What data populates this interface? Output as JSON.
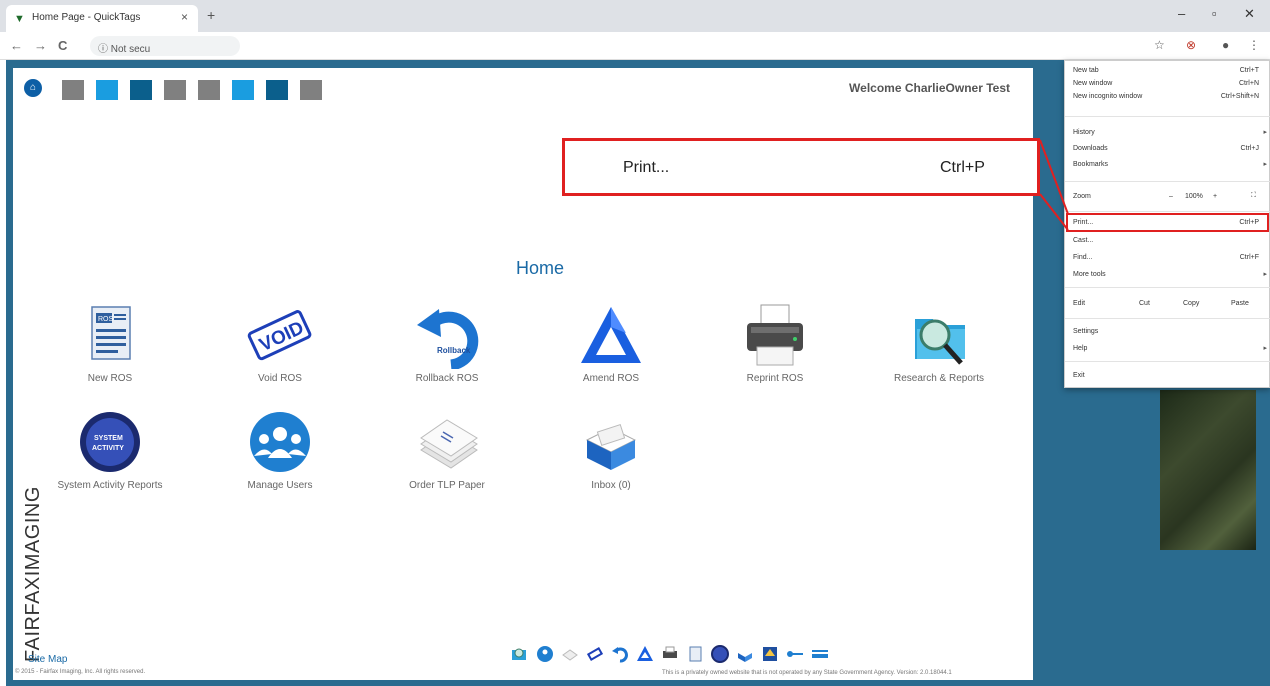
{
  "browser": {
    "tab_title": "Home Page - QuickTags",
    "tab_close": "×",
    "new_tab": "+",
    "address": "ⓘ Not secu",
    "window_controls": [
      "–",
      "▫",
      "✕"
    ],
    "nav": {
      "back": "←",
      "forward": "→",
      "reload": "C"
    },
    "toolbar_icons": {
      "star": "☆",
      "extension": "⊗",
      "profile": "●",
      "menu": "⋮"
    }
  },
  "page": {
    "welcome": "Welcome CharlieOwner Test",
    "title": "Home",
    "nav_tile_colors": [
      "#808080",
      "#1a9de0",
      "#0b5f8c",
      "#808080",
      "#808080",
      "#1a9de0",
      "#0b5f8c",
      "#808080"
    ],
    "menu_items": [
      {
        "label": "New ROS",
        "icon": "new-ros-icon"
      },
      {
        "label": "Void ROS",
        "icon": "void-stamp-icon"
      },
      {
        "label": "Rollback ROS",
        "icon": "rollback-arrow-icon"
      },
      {
        "label": "Amend ROS",
        "icon": "triangle-icon"
      },
      {
        "label": "Reprint ROS",
        "icon": "printer-icon"
      },
      {
        "label": "Research & Reports",
        "icon": "folder-magnifier-icon"
      },
      {
        "label": "System Activity Reports",
        "icon": "system-activity-icon"
      },
      {
        "label": "Manage Users",
        "icon": "users-icon"
      },
      {
        "label": "Order TLP Paper",
        "icon": "paper-stack-icon"
      },
      {
        "label": "Inbox (0)",
        "icon": "inbox-icon"
      }
    ],
    "icon_text": {
      "ros": "ROS",
      "void": "VOID",
      "rollback": "Rollback",
      "system": "SYSTEM",
      "activity": "ACTIVITY"
    },
    "brand": "FAIRFAXIMAGING",
    "site_map": "Site Map",
    "copyright": "© 2015 - Fairfax Imaging, Inc. All rights reserved.",
    "disclaimer": "This is a privately owned website that is not operated by any State Government Agency. Version: 2.0.18044.1"
  },
  "chrome_menu": {
    "new_tab": {
      "label": "New tab",
      "shortcut": "Ctrl+T"
    },
    "new_window": {
      "label": "New window",
      "shortcut": "Ctrl+N"
    },
    "incognito": {
      "label": "New incognito window",
      "shortcut": "Ctrl+Shift+N"
    },
    "history": {
      "label": "History"
    },
    "downloads": {
      "label": "Downloads",
      "shortcut": "Ctrl+J"
    },
    "bookmarks": {
      "label": "Bookmarks"
    },
    "zoom": {
      "label": "Zoom",
      "minus": "–",
      "value": "100%",
      "plus": "+",
      "fullscreen": "⛶"
    },
    "print": {
      "label": "Print...",
      "shortcut": "Ctrl+P"
    },
    "cast": {
      "label": "Cast..."
    },
    "find": {
      "label": "Find...",
      "shortcut": "Ctrl+F"
    },
    "more_tools": {
      "label": "More tools"
    },
    "edit": {
      "label": "Edit",
      "cut": "Cut",
      "copy": "Copy",
      "paste": "Paste"
    },
    "settings": {
      "label": "Settings"
    },
    "help": {
      "label": "Help"
    },
    "exit": {
      "label": "Exit"
    },
    "submenu_arrow": "▸"
  },
  "callout": {
    "label": "Print...",
    "shortcut": "Ctrl+P"
  }
}
